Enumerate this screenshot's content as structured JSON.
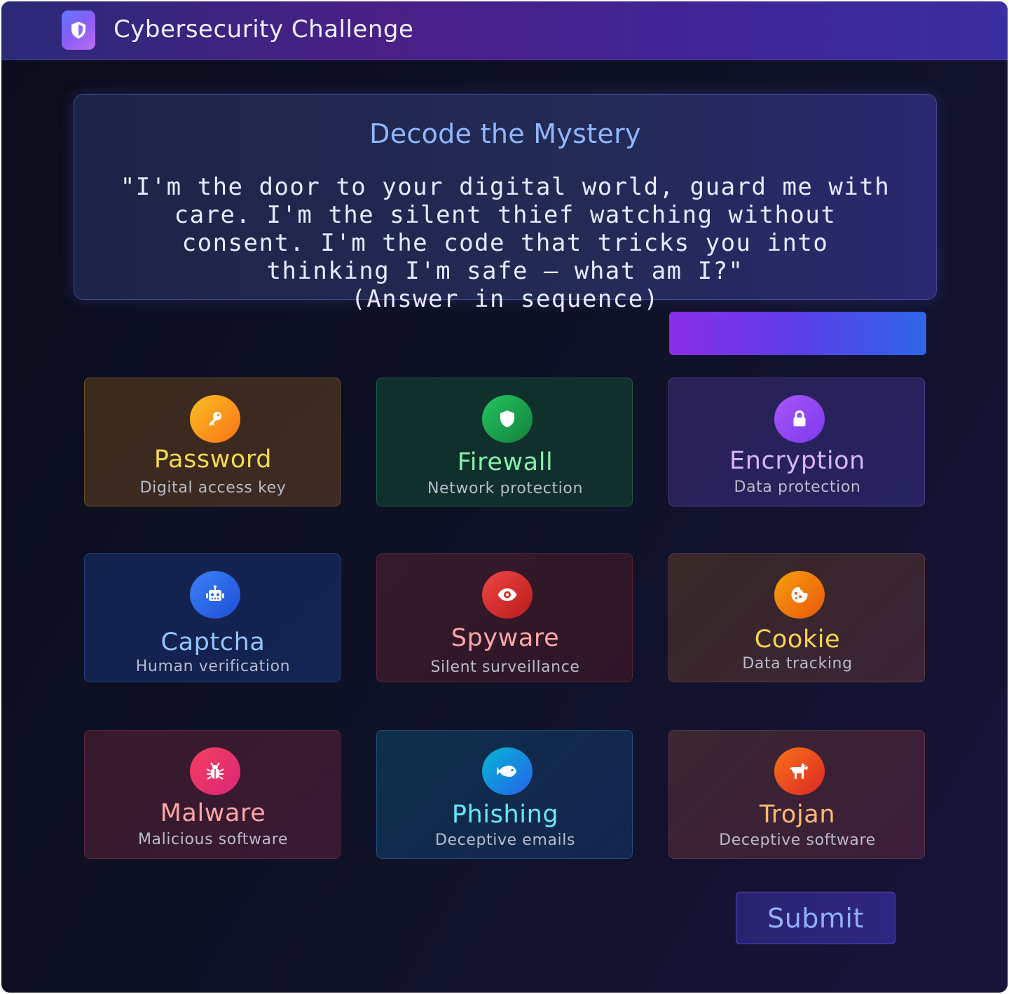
{
  "app": {
    "title": "Cybersecurity Challenge",
    "logo_icon": "shield-icon"
  },
  "riddle": {
    "heading": "Decode the Mystery",
    "text": "\"I'm the door to your digital world, guard me with care. I'm the silent thief watching without consent. I'm the code that tricks you into thinking I'm safe — what am I?\"",
    "note": "(Answer in sequence)"
  },
  "answer_bar": {
    "text": " "
  },
  "tiles": [
    {
      "name": "Password",
      "desc": "Digital access key",
      "icon": "key-icon",
      "name_color": "#f5d84e",
      "icon_colors": [
        "#fbbf24",
        "#f97316"
      ]
    },
    {
      "name": "Firewall",
      "desc": "Network protection",
      "icon": "shield-icon",
      "name_color": "#86efac",
      "icon_colors": [
        "#22c55e",
        "#15803d"
      ]
    },
    {
      "name": "Encryption",
      "desc": "Data protection",
      "icon": "lock-icon",
      "name_color": "#d8b4fe",
      "icon_colors": [
        "#a855f7",
        "#7c3aed"
      ]
    },
    {
      "name": "Captcha",
      "desc": "Human verification",
      "icon": "robot-icon",
      "name_color": "#93c5fd",
      "icon_colors": [
        "#3b82f6",
        "#1d4ed8"
      ]
    },
    {
      "name": "Spyware",
      "desc": "Silent surveillance",
      "icon": "eye-icon",
      "name_color": "#fca5a5",
      "icon_colors": [
        "#ef4444",
        "#b91c1c"
      ]
    },
    {
      "name": "Cookie",
      "desc": "Data tracking",
      "icon": "cookie-icon",
      "name_color": "#fcd34d",
      "icon_colors": [
        "#f59e0b",
        "#ea580c"
      ]
    },
    {
      "name": "Malware",
      "desc": "Malicious software",
      "icon": "bug-icon",
      "name_color": "#fca5a5",
      "icon_colors": [
        "#f43f5e",
        "#db2777"
      ]
    },
    {
      "name": "Phishing",
      "desc": "Deceptive emails",
      "icon": "fish-icon",
      "name_color": "#67e8f9",
      "icon_colors": [
        "#06b6d4",
        "#2563eb"
      ]
    },
    {
      "name": "Trojan",
      "desc": "Deceptive software",
      "icon": "horse-icon",
      "name_color": "#fdba74",
      "icon_colors": [
        "#f97316",
        "#dc2626"
      ]
    }
  ],
  "submit": {
    "label": "Submit"
  }
}
